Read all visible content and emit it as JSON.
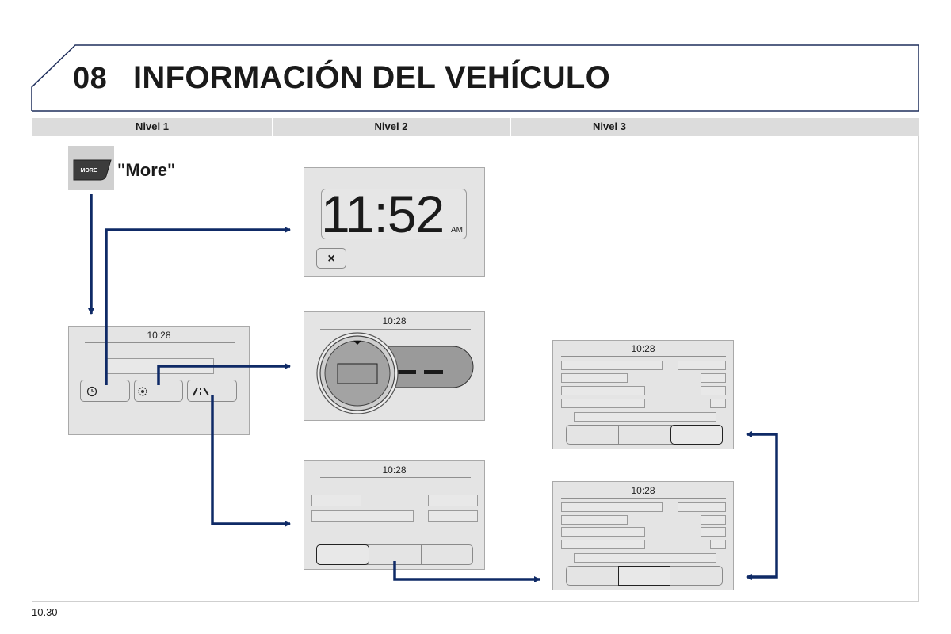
{
  "header": {
    "number": "08",
    "title": "INFORMACIÓN DEL VEHÍCULO"
  },
  "columns": [
    "Nivel 1",
    "Nivel 2",
    "Nivel 3"
  ],
  "more_button": {
    "key_label": "MORE",
    "caption": "\"More\""
  },
  "screen_time": "10:28",
  "clock": {
    "time": "11:52",
    "ampm": "AM",
    "close": "×"
  },
  "level1_icons": [
    "clock-icon",
    "settings-icon",
    "road-icon"
  ],
  "footer": {
    "page": "10.30"
  }
}
